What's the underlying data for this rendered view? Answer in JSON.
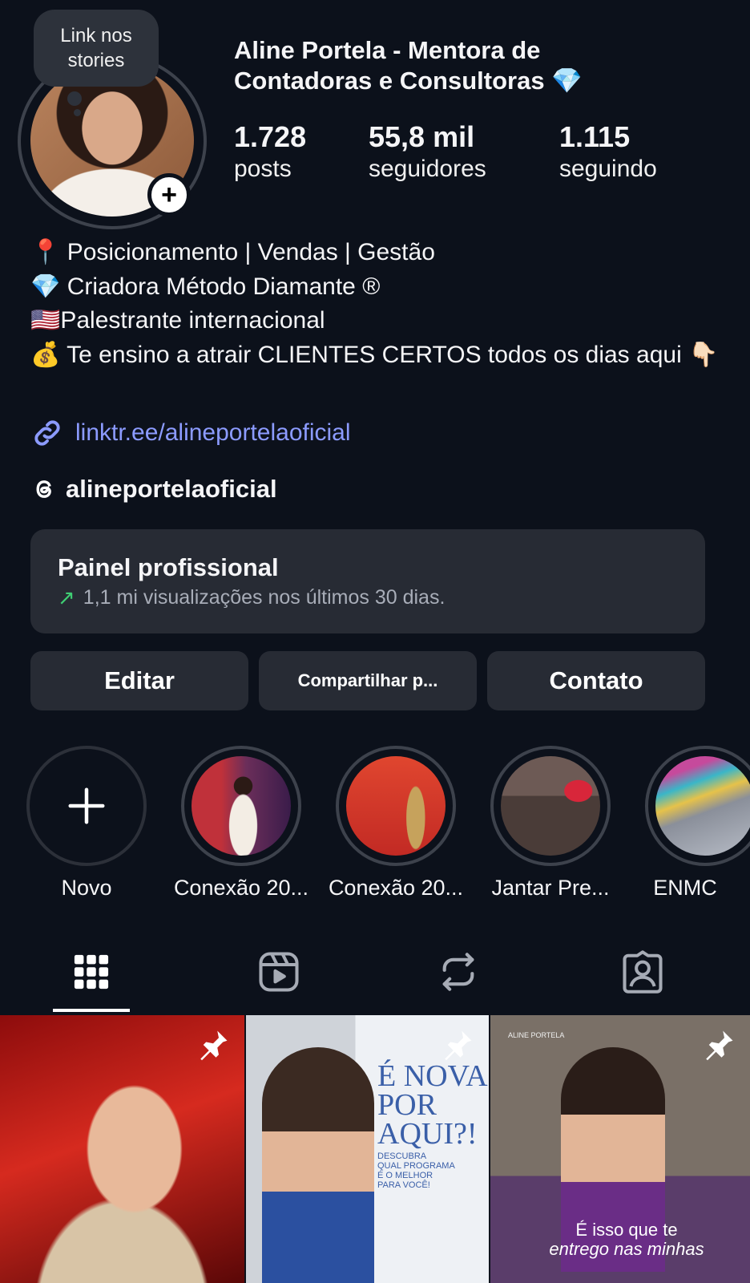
{
  "profile": {
    "note_line1": "Link nos",
    "note_line2": "stories",
    "name_line1": "Aline Portela - Mentora de",
    "name_line2": "Contadoras e Consultoras",
    "name_emoji": "💎"
  },
  "stats": [
    {
      "value": "1.728",
      "label": "posts"
    },
    {
      "value": "55,8 mil",
      "label": "seguidores"
    },
    {
      "value": "1.115",
      "label": "seguindo"
    }
  ],
  "bio": {
    "line1": "📍 Posicionamento | Vendas | Gestão",
    "line2": "💎  Criadora Método Diamante ®",
    "line3": "🇺🇸Palestrante internacional",
    "line4": "💰 Te ensino a atrair CLIENTES CERTOS todos os dias aqui 👇🏻"
  },
  "link": "linktr.ee/alineportelaoficial",
  "threads_handle": "alineportelaoficial",
  "panel": {
    "title": "Painel profissional",
    "arrow": "↗",
    "subtitle": "1,1 mi visualizações nos últimos 30 dias."
  },
  "buttons": {
    "edit": "Editar",
    "share": "Compartilhar p...",
    "contact": "Contato"
  },
  "highlights": [
    {
      "label": "Novo",
      "icon": "plus-icon"
    },
    {
      "label": "Conexão 20..."
    },
    {
      "label": "Conexão 20..."
    },
    {
      "label": "Jantar Pre..."
    },
    {
      "label": "ENMC"
    }
  ],
  "tabs": [
    "grid-icon",
    "reels-icon",
    "reposts-icon",
    "tagged-icon"
  ],
  "posts": [
    {
      "pinned": true
    },
    {
      "pinned": true,
      "headline_line1": "É NOVA",
      "headline_line2": "POR",
      "headline_line3": "AQUI?!",
      "sub_line1": "DESCUBRA",
      "sub_line2": "QUAL PROGRAMA",
      "sub_line3": "É O MELHOR",
      "sub_line4": "PARA VOCÊ!"
    },
    {
      "pinned": true,
      "brand": "ALINE PORTELA",
      "caption_line1": "É isso que te",
      "caption_line2": "entrego nas minhas"
    }
  ],
  "colors": {
    "background": "#0c111b",
    "card": "#272b34",
    "link": "#8c9bff",
    "trend_green": "#3fce73",
    "ring": "#3d424c"
  }
}
